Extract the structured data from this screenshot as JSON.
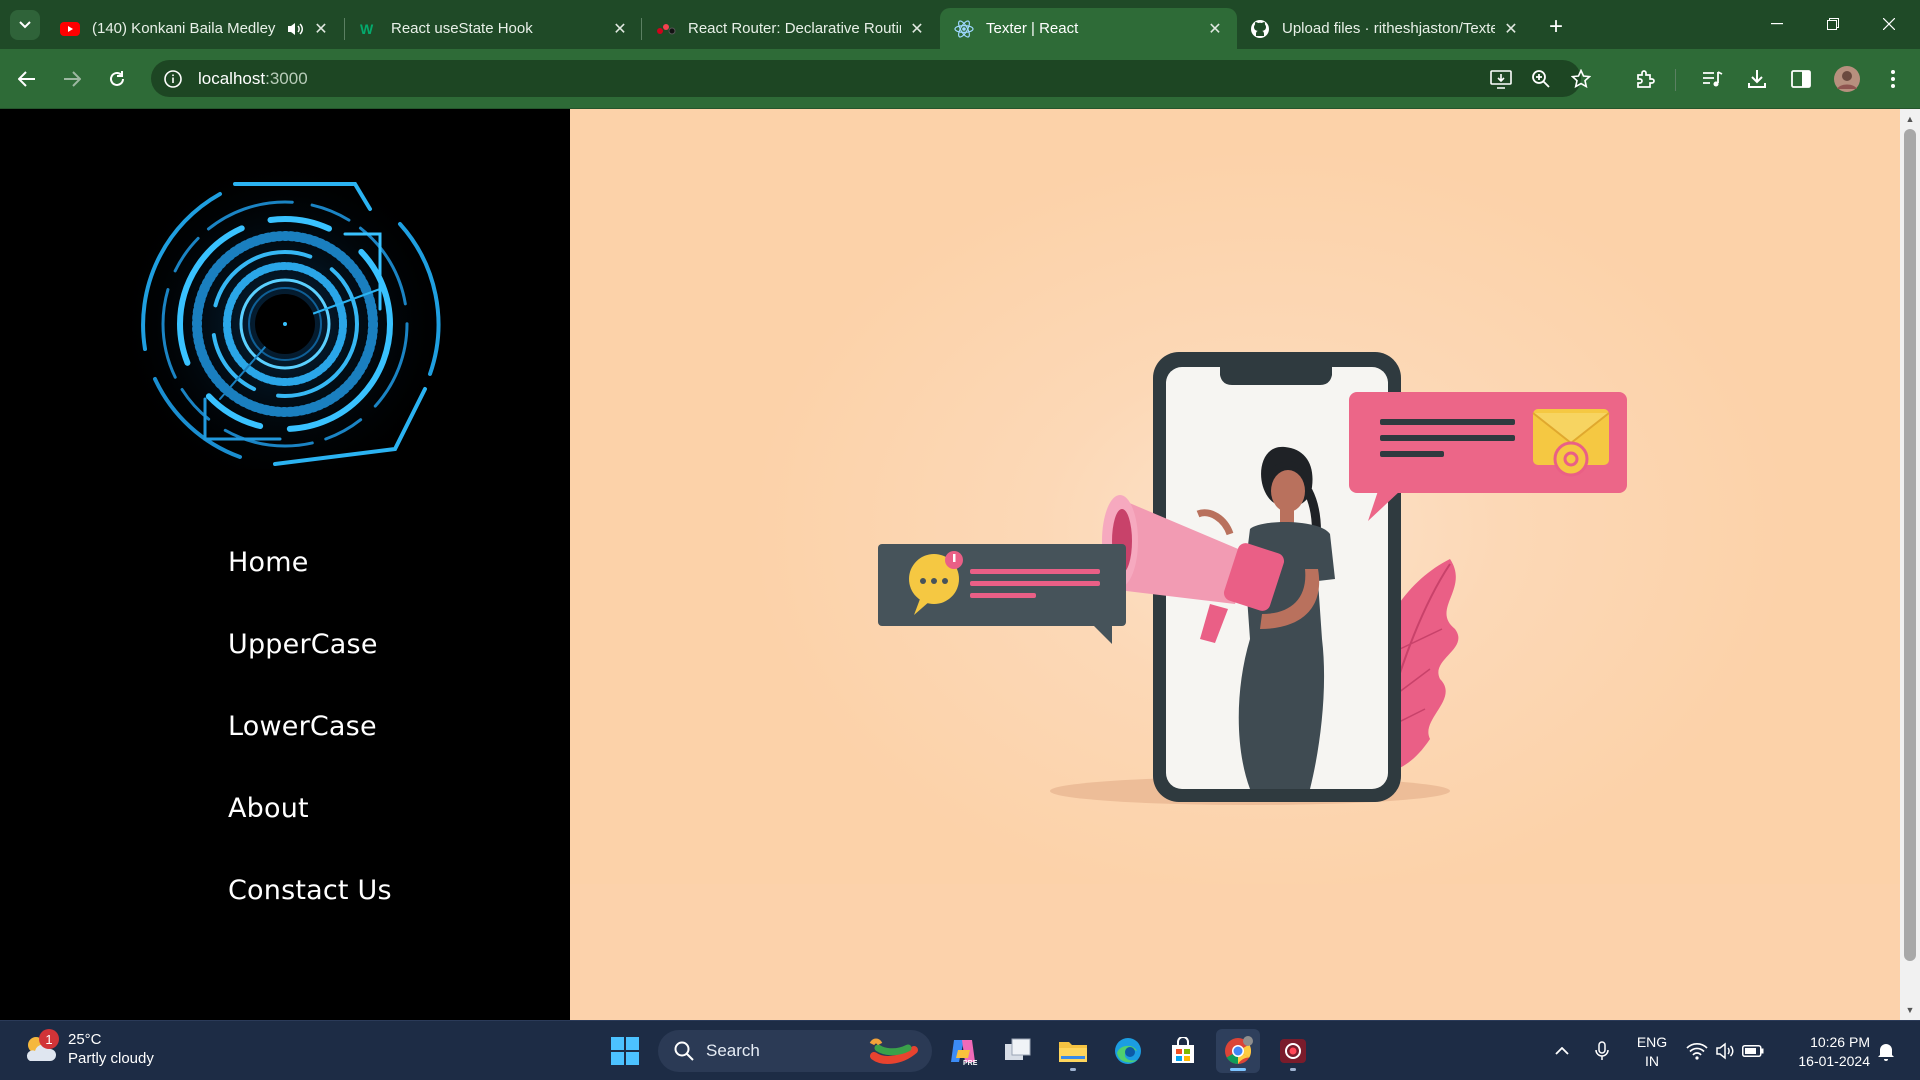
{
  "browser": {
    "tabs": [
      {
        "title": "(140) Konkani Baila Medley",
        "favicon": "youtube-icon",
        "audio": true
      },
      {
        "title": "React useState Hook",
        "favicon": "w3schools-icon",
        "audio": false
      },
      {
        "title": "React Router: Declarative Routing",
        "favicon": "react-router-icon",
        "audio": false
      },
      {
        "title": "Texter | React",
        "favicon": "react-icon",
        "audio": false,
        "active": true
      },
      {
        "title": "Upload files · ritheshjaston/Texter",
        "favicon": "github-icon",
        "audio": false
      }
    ],
    "url_host": "localhost",
    "url_port": ":3000",
    "accent": "#2e6b37"
  },
  "sidebar": {
    "logo": "cyber-eye-logo",
    "links": [
      "Home",
      "UpperCase",
      "LowerCase",
      "About",
      "Constact Us"
    ]
  },
  "main": {
    "illustration": "woman-megaphone-phone-illustration",
    "background": "#fcd3ad"
  },
  "taskbar": {
    "weather": {
      "temp": "25°C",
      "condition": "Partly cloudy",
      "badge": "1"
    },
    "search_label": "Search",
    "lang_line1": "ENG",
    "lang_line2": "IN",
    "time": "10:26 PM",
    "date": "16-01-2024"
  }
}
